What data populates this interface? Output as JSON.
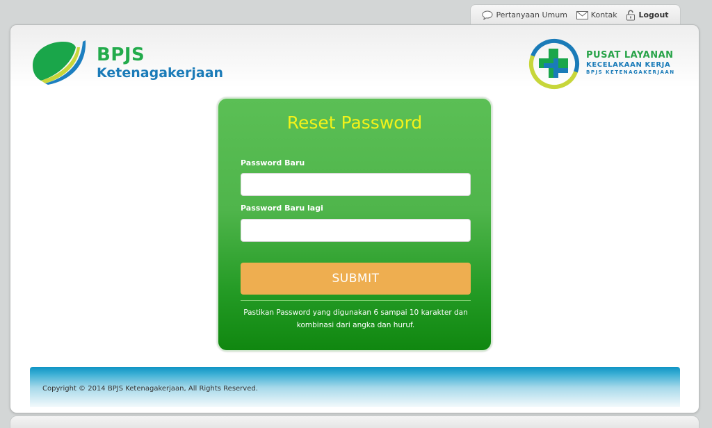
{
  "nav": {
    "faq_label": "Pertanyaan Umum",
    "contact_label": "Kontak",
    "logout_label": "Logout"
  },
  "branding": {
    "left_line1": "BPJS",
    "left_line2": "Ketenagakerjaan",
    "right_line1": "PUSAT LAYANAN",
    "right_line2": "KECELAKAAN KERJA",
    "right_line3": "BPJS KETENAGAKERJAAN"
  },
  "form": {
    "title": "Reset Password",
    "new_password_label": "Password Baru",
    "new_password_value": "",
    "confirm_password_label": "Password Baru lagi",
    "confirm_password_value": "",
    "submit_label": "SUBMIT",
    "hint": "Pastikan Password yang digunakan 6 sampai 10 karakter dan kombinasi dari angka dan huruf."
  },
  "footer": {
    "copyright": "Copyright © 2014 BPJS Ketenagakerjaan, All Rights Reserved."
  },
  "colors": {
    "brand_green": "#23ab4c",
    "brand_blue": "#1a7bb8",
    "card_green": "#4fb54b",
    "title_yellow": "#f2f21a",
    "submit_orange": "#eeae50",
    "footer_blue": "#0e94c4"
  },
  "icons": {
    "faq": "speech-bubble-icon",
    "contact": "envelope-icon",
    "logout": "padlock-icon"
  }
}
